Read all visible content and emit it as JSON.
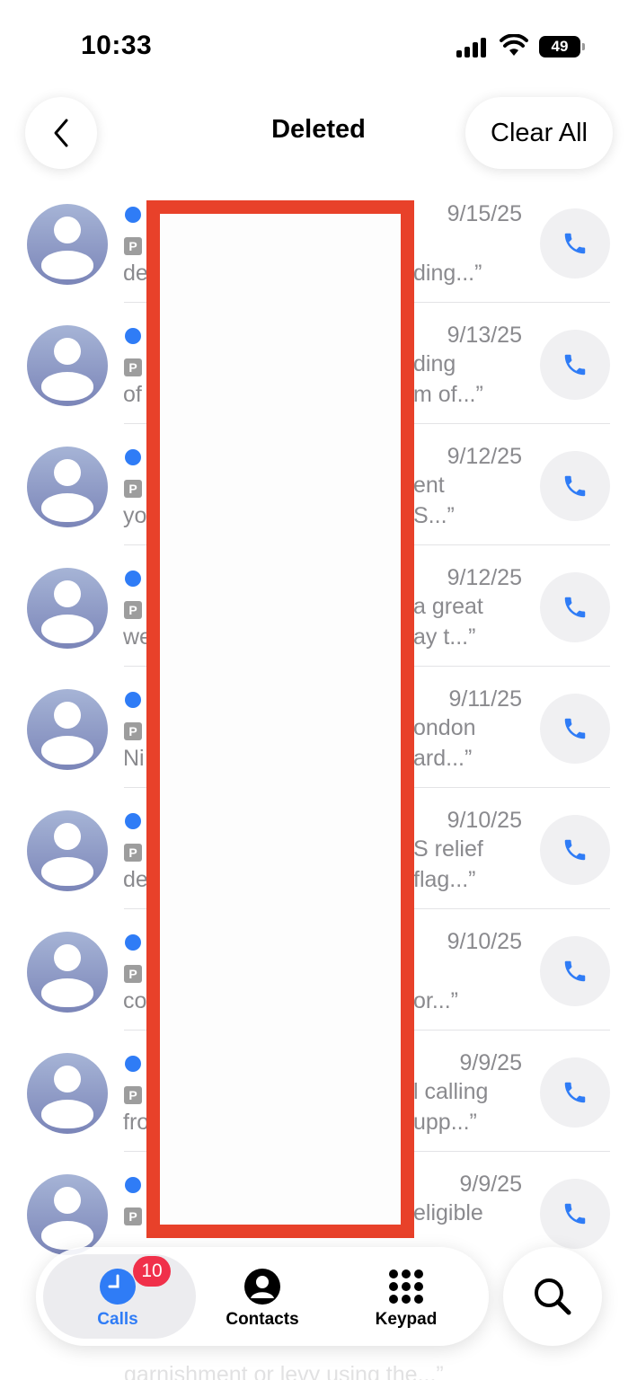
{
  "status_bar": {
    "time": "10:33",
    "battery": "49"
  },
  "header": {
    "title": "Deleted",
    "clear_all_label": "Clear All"
  },
  "calls": [
    {
      "date": "9/15/25",
      "snippet_start": "de",
      "snippet_line1": "",
      "snippet_line2": "ding...”"
    },
    {
      "date": "9/13/25",
      "snippet_start": "of",
      "snippet_line1": "ding",
      "snippet_line2": "m of...”"
    },
    {
      "date": "9/12/25",
      "snippet_start": "yo",
      "snippet_line1": "ent",
      "snippet_line2": "S...”"
    },
    {
      "date": "9/12/25",
      "snippet_start": "we",
      "snippet_line1": "a great",
      "snippet_line2": "ay t...”"
    },
    {
      "date": "9/11/25",
      "snippet_start": "Ni",
      "snippet_line1": "ondon",
      "snippet_line2": "ard...”"
    },
    {
      "date": "9/10/25",
      "snippet_start": "de",
      "snippet_line1": "S relief",
      "snippet_line2": "flag...”"
    },
    {
      "date": "9/10/25",
      "snippet_start": "co",
      "snippet_line1": "",
      "snippet_line2": "or...”"
    },
    {
      "date": "9/9/25",
      "snippet_start": "fro",
      "snippet_line1": "l calling",
      "snippet_line2": "upp...”"
    },
    {
      "date": "9/9/25",
      "snippet_start": "",
      "snippet_line1": "eligible",
      "snippet_line2": ""
    }
  ],
  "faded_row": {
    "text": "garnishment or levy using the...”"
  },
  "tabs": {
    "calls_label": "Calls",
    "contacts_label": "Contacts",
    "keypad_label": "Keypad",
    "calls_badge": "10"
  },
  "colors": {
    "accent": "#2f7cf6",
    "badge": "#f0304a",
    "redaction": "#e8412a"
  }
}
